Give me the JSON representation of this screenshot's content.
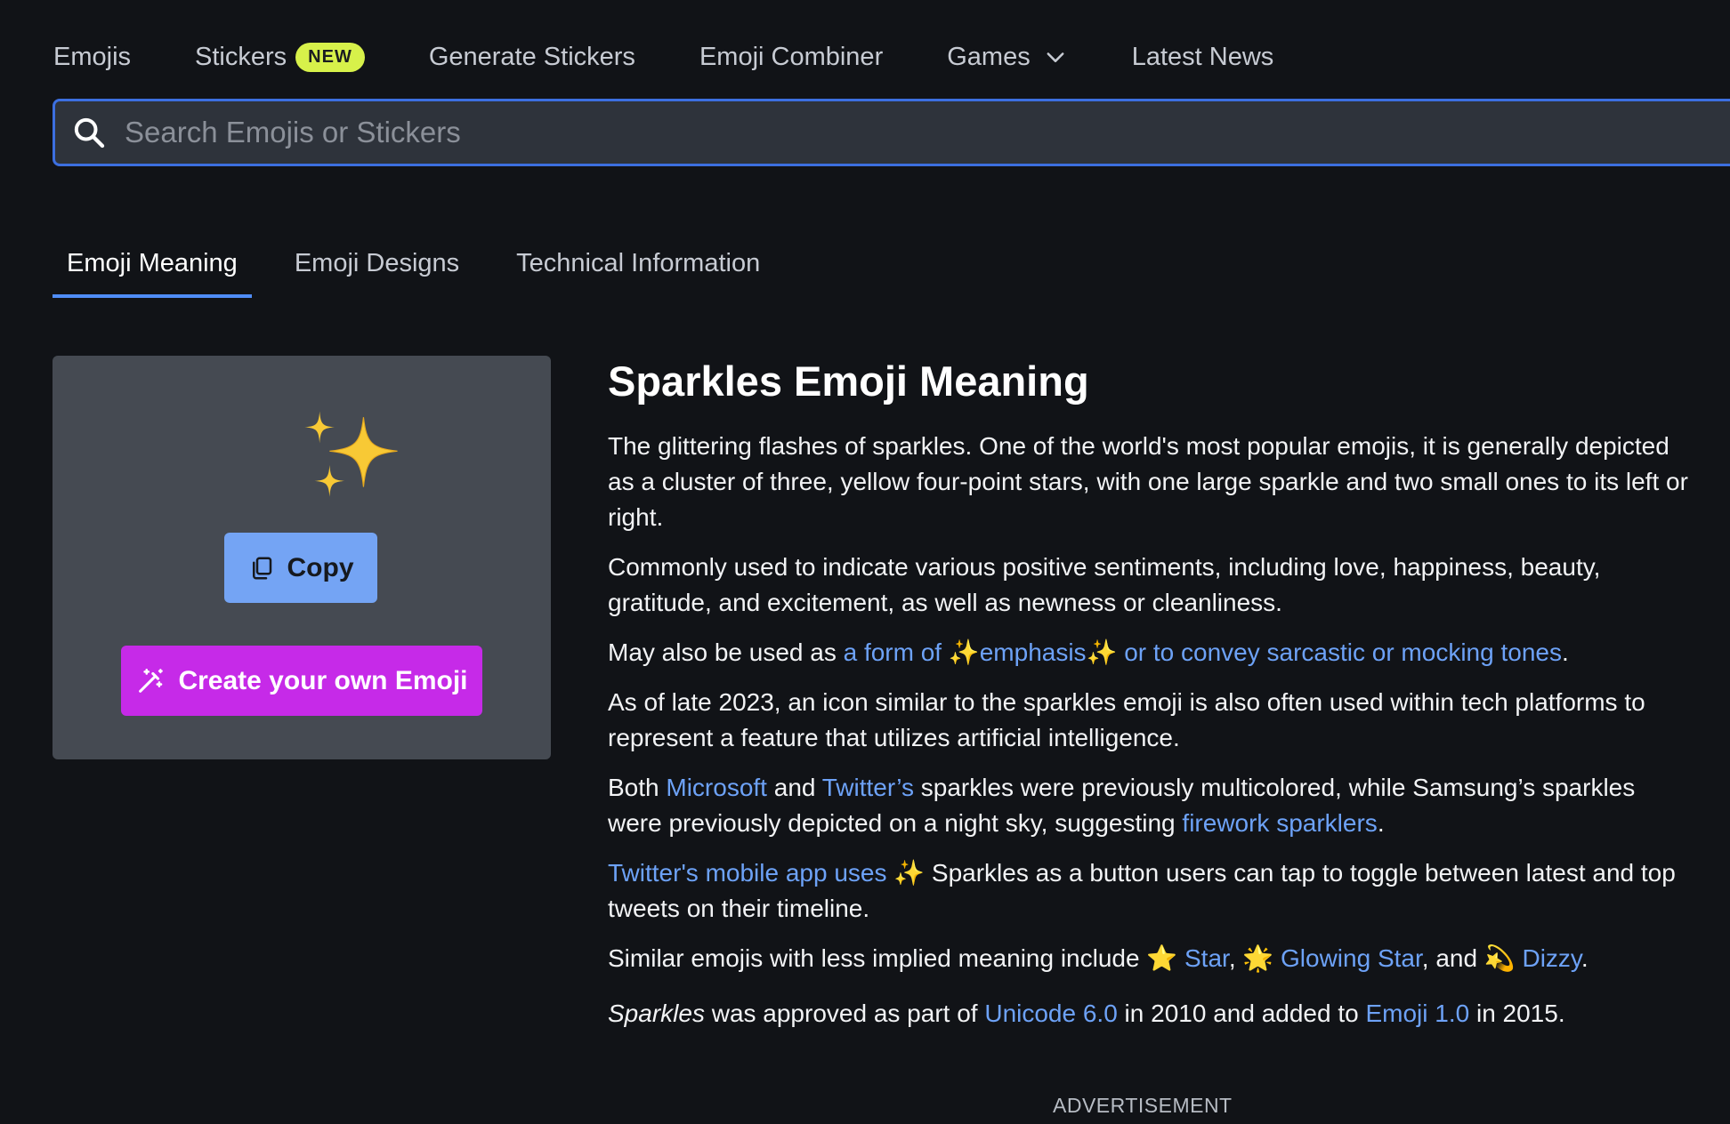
{
  "nav": {
    "emojis": "Emojis",
    "stickers": "Stickers",
    "stickers_badge": "NEW",
    "generate": "Generate Stickers",
    "combiner": "Emoji Combiner",
    "games": "Games",
    "news": "Latest News"
  },
  "search": {
    "placeholder": "Search Emojis or Stickers",
    "value": ""
  },
  "tabs": {
    "meaning": "Emoji Meaning",
    "designs": "Emoji Designs",
    "technical": "Technical Information"
  },
  "card": {
    "emoji": "✨",
    "copy_label": "Copy",
    "create_label": "Create your own Emoji"
  },
  "content": {
    "title": "Sparkles Emoji Meaning",
    "p1": "The glittering flashes of sparkles. One of the world's most popular emojis, it is generally depicted as a cluster of three, yellow four-point stars, with one large sparkle and two small ones to its left or right.",
    "p2": "Commonly used to indicate various positive sentiments, including love, happiness, beauty, gratitude, and excitement, as well as newness or cleanliness.",
    "p3_pre": "May also be used as ",
    "p3_link": "a form of ✨emphasis✨ or to convey sarcastic or mocking tones",
    "p3_post": ".",
    "p4": "As of late 2023, an icon similar to the sparkles emoji is also often used within tech platforms to represent a feature that utilizes artificial intelligence.",
    "p5_a": "Both ",
    "p5_link1": "Microsoft",
    "p5_b": " and ",
    "p5_link2": "Twitter’s",
    "p5_c": " sparkles were previously multicolored, while Samsung’s sparkles were previously depicted on a night sky, suggesting ",
    "p5_link3": "firework sparklers",
    "p5_d": ".",
    "p6_link": "Twitter's mobile app uses",
    "p6_text": " ✨ Sparkles as a button users can tap to toggle between latest and top tweets on their timeline.",
    "p7_pre": "Similar emojis with less implied meaning include ⭐ ",
    "p7_link1": "Star",
    "p7_b": ", 🌟 ",
    "p7_link2": "Glowing Star",
    "p7_c": ", and 💫 ",
    "p7_link3": "Dizzy",
    "p7_d": ".",
    "p8_em": "Sparkles",
    "p8_a": " was approved as part of ",
    "p8_link1": "Unicode 6.0",
    "p8_b": " in 2010 and added to ",
    "p8_link2": "Emoji 1.0",
    "p8_c": " in 2015."
  },
  "advertisement": "ADVERTISEMENT",
  "colors": {
    "background": "#111317",
    "link": "#6da2f7",
    "accent_blue": "#3c6fe0",
    "copy_button": "#74a4f4",
    "create_button": "#c62ae8",
    "badge": "#d7f14a"
  }
}
